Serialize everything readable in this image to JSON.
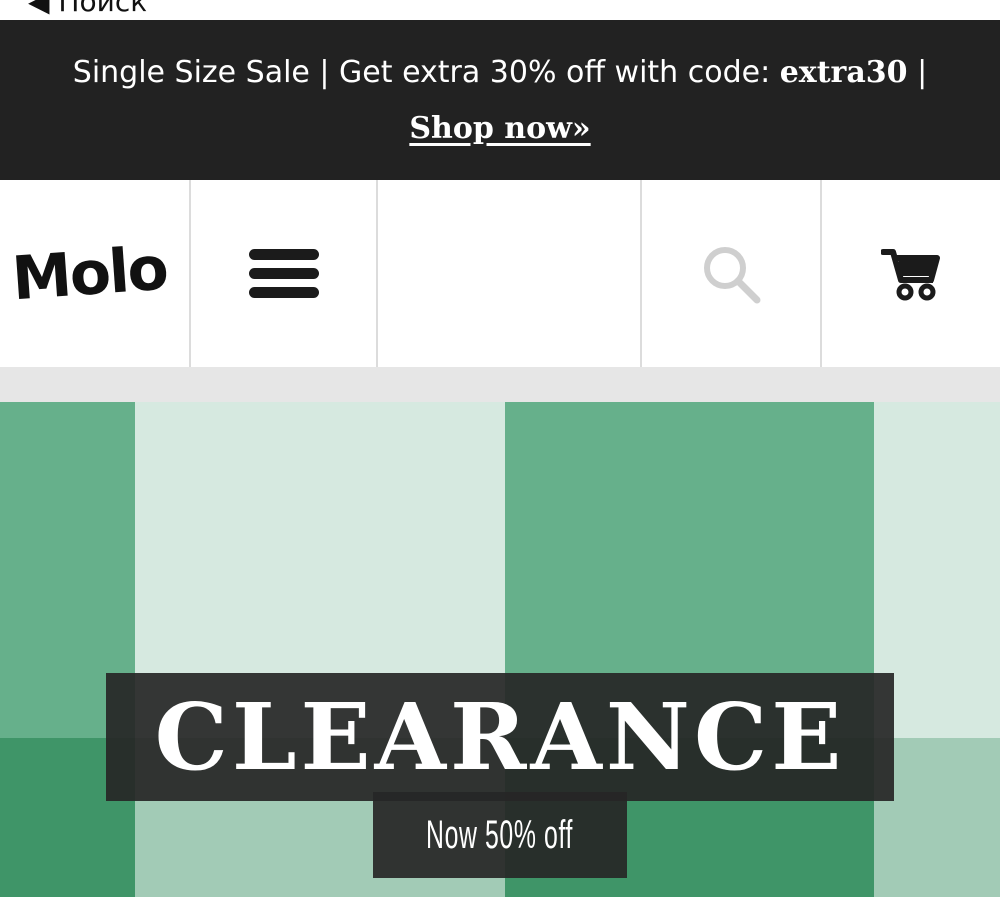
{
  "nav": {
    "back_label": "◀ Поиск"
  },
  "promo": {
    "text": "Single Size Sale | Get extra 30% off with code: ",
    "code": "extra30",
    "separator": " |",
    "link_label": "Shop now»"
  },
  "header": {
    "logo_text": "Molo",
    "menu_icon": "hamburger-menu-icon",
    "search_icon": "search-icon",
    "cart_icon": "cart-icon"
  },
  "hero": {
    "title": "CLEARANCE",
    "subtitle": "Now 50% off"
  },
  "colors": {
    "promo_bg": "#222222",
    "hero_green_dark": "#3f9568",
    "hero_green_mid": "#66b08b",
    "hero_green_light": "#d6e9e0",
    "hero_green_pale": "#a2cbb6",
    "search_icon_color": "#cfcfcf"
  }
}
